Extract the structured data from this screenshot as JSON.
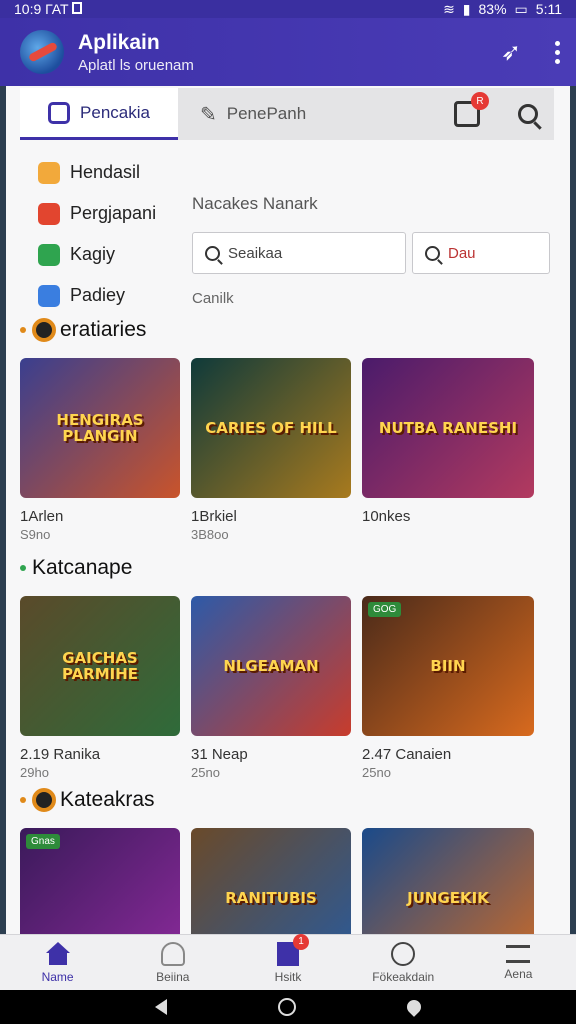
{
  "status": {
    "time": "10:9 ГАТ",
    "battery": "83%",
    "clock": "5:11"
  },
  "app": {
    "title": "Aplikain",
    "subtitle": "Aplatl ls oruenam"
  },
  "tabs": {
    "active": "Pencakia",
    "alt": "PenePanh",
    "badge": "R"
  },
  "menu": [
    {
      "label": "Hendasil",
      "color": "#f2a93b"
    },
    {
      "label": "Pergjapani",
      "color": "#e2452f"
    },
    {
      "label": "Kagiy",
      "color": "#2fa44f"
    },
    {
      "label": "Padiey",
      "color": "#3a7ee0"
    }
  ],
  "panel": {
    "label": "Nacakes Nanark",
    "search1": "Seaikaa",
    "search2": "Dau",
    "footer": "Canilk"
  },
  "sections": [
    {
      "title": "eratiaries",
      "cards": [
        {
          "art": "HENGIRAS PLANGIN",
          "name": "1Arlen",
          "sub": "S9no",
          "bg": "linear-gradient(135deg,#3a3f8f,#c9542b)"
        },
        {
          "art": "CARIES OF HILL",
          "name": "1Brkiel",
          "sub": "3B8oo",
          "bg": "linear-gradient(135deg,#0f3a3a,#a87a1e)"
        },
        {
          "art": "NUTBA RANESHI",
          "name": "10nkes",
          "sub": "",
          "bg": "linear-gradient(135deg,#4a1b6b,#b33a5f)"
        }
      ]
    },
    {
      "title": "Katcanape",
      "cards": [
        {
          "art": "GAICHAS PARMIHE",
          "name": "2.19 Ranika",
          "sub": "29ho",
          "bg": "linear-gradient(135deg,#5a4a2a,#2f6b3a)"
        },
        {
          "art": "NLGEAMAN",
          "name": "31 Neap",
          "sub": "25no",
          "bg": "linear-gradient(135deg,#2d5aa8,#c83c2c)"
        },
        {
          "art": "BIIN",
          "name": "2.47 Canaien",
          "sub": "25no",
          "bg": "linear-gradient(135deg,#4a2a1a,#d86a1e)",
          "tag": "GOG"
        }
      ]
    },
    {
      "title": "Kateakras",
      "cards": [
        {
          "art": "",
          "name": "",
          "sub": "",
          "bg": "linear-gradient(135deg,#3a1a5a,#8a2a9a)",
          "tag": "Gnas"
        },
        {
          "art": "RANITUBIS",
          "name": "",
          "sub": "",
          "bg": "linear-gradient(135deg,#6a4a2a,#2a5a9a)"
        },
        {
          "art": "JUNGEKIK",
          "name": "",
          "sub": "",
          "bg": "linear-gradient(135deg,#1a4a8a,#c86a2a)"
        }
      ]
    }
  ],
  "nav": [
    {
      "label": "Name",
      "active": true
    },
    {
      "label": "Beiina",
      "active": false
    },
    {
      "label": "Hsitk",
      "active": false,
      "badge": "1"
    },
    {
      "label": "Fökeakdain",
      "active": false
    },
    {
      "label": "Aena",
      "active": false
    }
  ]
}
